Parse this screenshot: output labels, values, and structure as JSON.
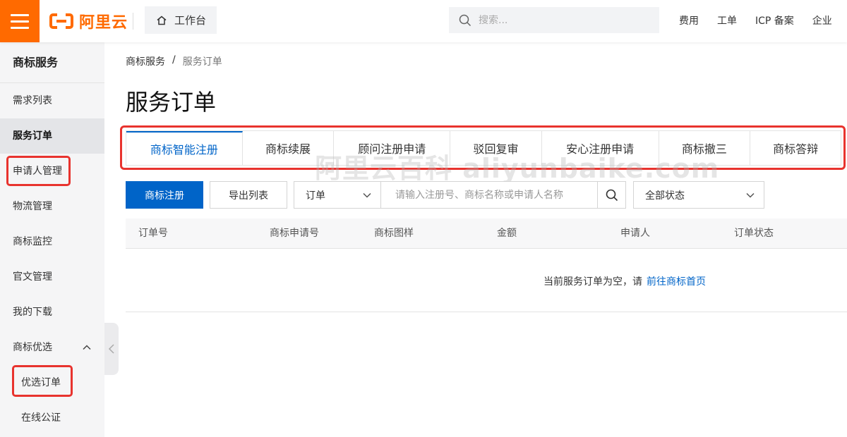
{
  "header": {
    "logo_text": "阿里云",
    "workbench_label": "工作台",
    "search_placeholder": "搜索...",
    "links": [
      "费用",
      "工单",
      "ICP 备案",
      "企业"
    ]
  },
  "sidebar": {
    "title": "商标服务",
    "items": [
      {
        "label": "需求列表"
      },
      {
        "label": "服务订单",
        "active": true
      },
      {
        "label": "申请人管理",
        "highlighted": true
      },
      {
        "label": "物流管理"
      },
      {
        "label": "商标监控"
      },
      {
        "label": "官文管理"
      },
      {
        "label": "我的下载"
      },
      {
        "label": "商标优选",
        "expanded": true
      },
      {
        "label": "优选订单",
        "sub": true,
        "highlighted": true
      },
      {
        "label": "在线公证",
        "sub": true
      }
    ]
  },
  "breadcrumb": {
    "parent": "商标服务",
    "separator": "/",
    "current": "服务订单"
  },
  "page_title": "服务订单",
  "tabs": [
    {
      "label": "商标智能注册",
      "active": true
    },
    {
      "label": "商标续展"
    },
    {
      "label": "顾问注册申请"
    },
    {
      "label": "驳回复审"
    },
    {
      "label": "安心注册申请"
    },
    {
      "label": "商标撤三"
    },
    {
      "label": "商标答辩"
    }
  ],
  "watermark": "阿里云百科 aliyunbaike.com",
  "toolbar": {
    "primary_label": "商标注册",
    "export_label": "导出列表",
    "type_select_value": "订单",
    "query_placeholder": "请输入注册号、商标名称或申请人名称",
    "status_select_value": "全部状态"
  },
  "table": {
    "columns": [
      "订单号",
      "商标申请号",
      "商标图样",
      "金额",
      "申请人",
      "订单状态"
    ],
    "empty_text": "当前服务订单为空，请",
    "empty_link": "前往商标首页"
  },
  "colors": {
    "brand": "#ff6a00",
    "primary": "#0064c8",
    "highlight": "#e8332e"
  }
}
